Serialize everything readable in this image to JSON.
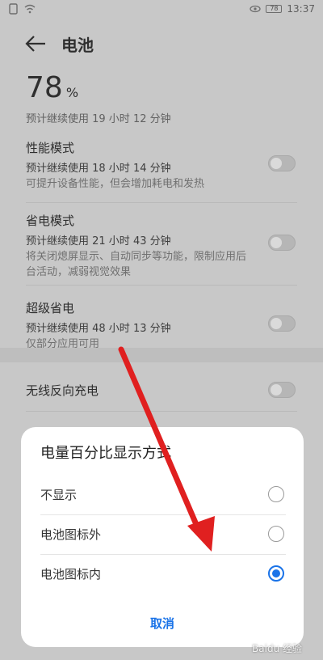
{
  "status_bar": {
    "time": "13:37",
    "battery_level": "78"
  },
  "header": {
    "title": "电池"
  },
  "battery": {
    "percent": "78",
    "percent_unit": "%",
    "remaining": "预计继续使用 19 小时 12 分钟"
  },
  "modes": [
    {
      "title": "性能模式",
      "estimate": "预计继续使用 18 小时 14 分钟",
      "desc": "可提升设备性能，但会增加耗电和发热"
    },
    {
      "title": "省电模式",
      "estimate": "预计继续使用 21 小时 43 分钟",
      "desc": "将关闭熄屏显示、自动同步等功能，限制应用后台活动，减弱视觉效果"
    },
    {
      "title": "超级省电",
      "estimate": "预计继续使用 48 小时 13 分钟",
      "desc": "仅部分应用可用"
    }
  ],
  "wireless": {
    "title": "无线反向充电"
  },
  "dialog": {
    "title": "电量百分比显示方式",
    "options": [
      "不显示",
      "电池图标外",
      "电池图标内"
    ],
    "selected_index": 2,
    "cancel": "取消"
  },
  "watermark": "Baidu 经验",
  "colors": {
    "accent": "#1a73e8",
    "arrow": "#e02020"
  }
}
